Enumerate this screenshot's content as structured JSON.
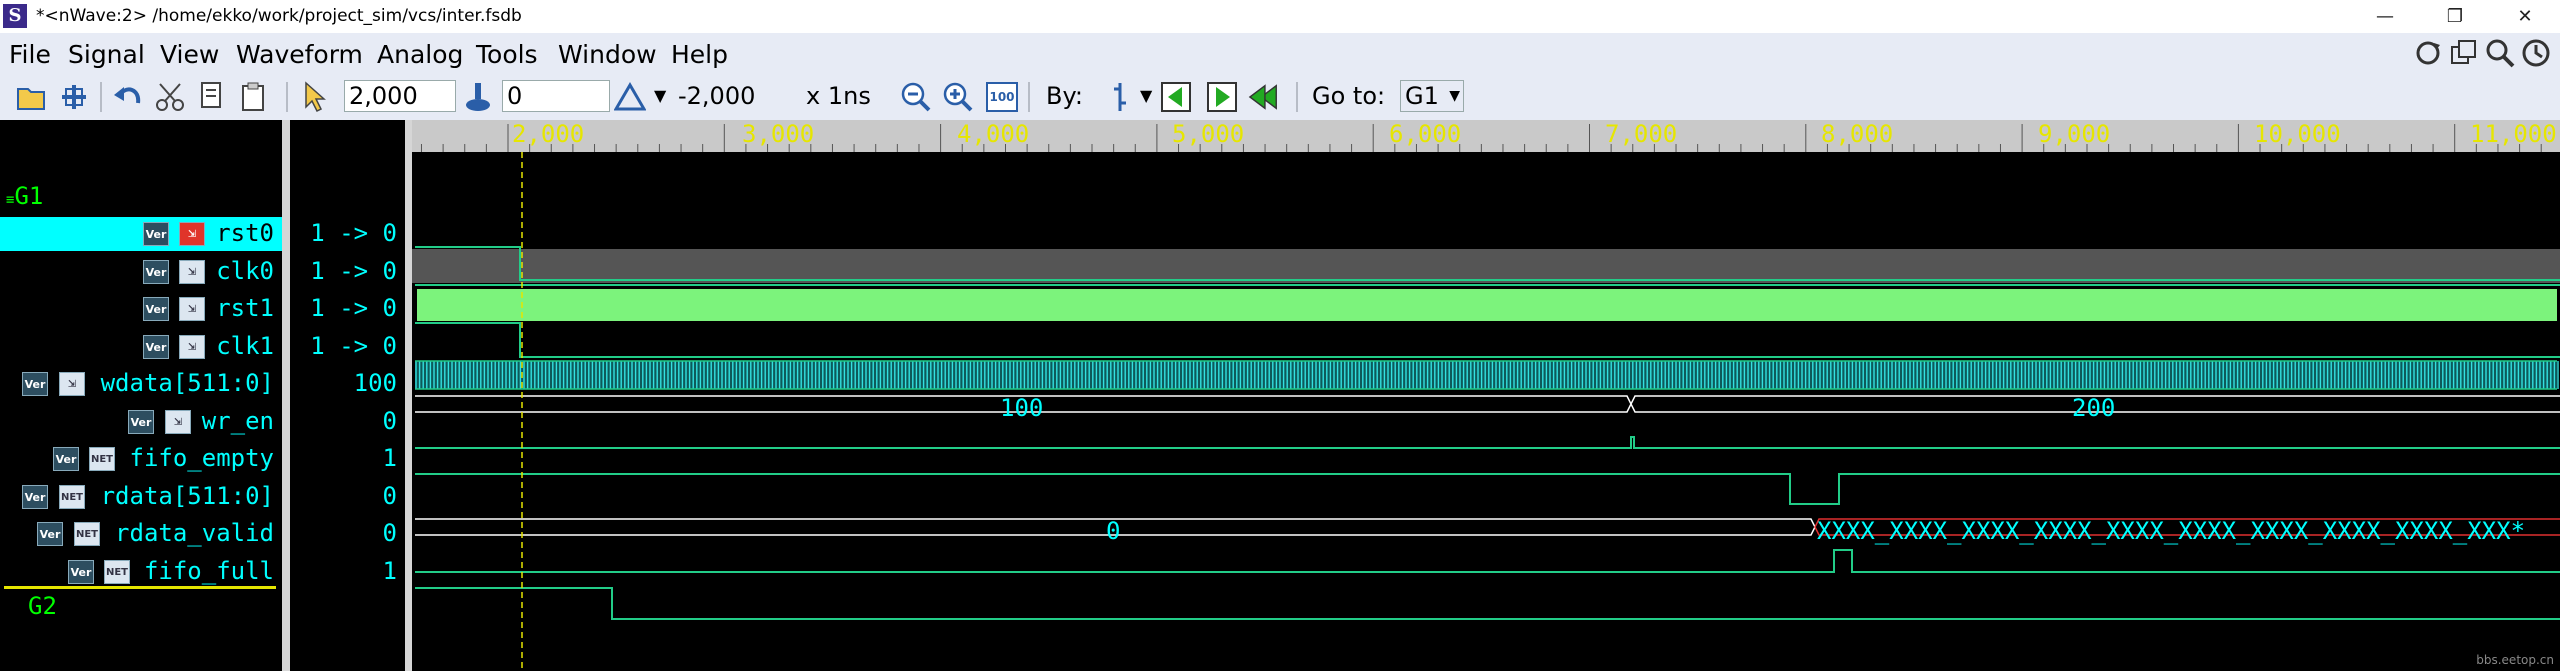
{
  "window": {
    "title": "*<nWave:2> /home/ekko/work/project_sim/vcs/inter.fsdb",
    "app_icon": "S",
    "controls": [
      "—",
      "❐",
      "✕"
    ]
  },
  "menu": [
    "File",
    "Signal",
    "View",
    "Waveform",
    "Analog",
    "Tools",
    "Window",
    "Help"
  ],
  "toolbar": {
    "cursor_time": "2,000",
    "marker_time": "0",
    "delta": "-2,000",
    "unit": "x 1ns",
    "zoom_fit": "100",
    "by_label": "By:",
    "goto_label": "Go to:",
    "goto_value": "G1"
  },
  "ruler": {
    "labels": [
      "2,000",
      "3,000",
      "4,000",
      "5,000",
      "6,000",
      "7,000",
      "8,000",
      "9,000",
      "10,000",
      "11,000"
    ]
  },
  "groups": {
    "g1": "G1",
    "g2": "G2"
  },
  "signals": [
    {
      "name": "rst0",
      "value": "1 -> 0",
      "type": "Ver",
      "kind": "in-red"
    },
    {
      "name": "clk0",
      "value": "1 -> 0",
      "type": "Ver",
      "kind": "in"
    },
    {
      "name": "rst1",
      "value": "1 -> 0",
      "type": "Ver",
      "kind": "in"
    },
    {
      "name": "clk1",
      "value": "1 -> 0",
      "type": "Ver",
      "kind": "in"
    },
    {
      "name": "wdata[511:0]",
      "value": "100",
      "type": "Ver",
      "kind": "in"
    },
    {
      "name": "wr_en",
      "value": "0",
      "type": "Ver",
      "kind": "in"
    },
    {
      "name": "fifo_empty",
      "value": "1",
      "type": "Ver",
      "kind": "net"
    },
    {
      "name": "rdata[511:0]",
      "value": "0",
      "type": "Ver",
      "kind": "net"
    },
    {
      "name": "rdata_valid",
      "value": "0",
      "type": "Ver",
      "kind": "net"
    },
    {
      "name": "fifo_full",
      "value": "1",
      "type": "Ver",
      "kind": "net"
    }
  ],
  "bus_values": {
    "wdata_a": "100",
    "wdata_b": "200",
    "rdata_a": "0",
    "rdata_b": "XXXX_XXXX_XXXX_XXXX_XXXX_XXXX_XXXX_XXXX_XXXX_XXX*"
  },
  "watermark": "bbs.eetop.cn",
  "colors": {
    "bg": "#000000",
    "signal_text": "#00ffff",
    "group_text": "#00ff00",
    "wave_green": "#22cc88",
    "clk0_fill": "#7cf37c",
    "ruler_text": "#e6e600",
    "cursor": "#e6e600"
  }
}
